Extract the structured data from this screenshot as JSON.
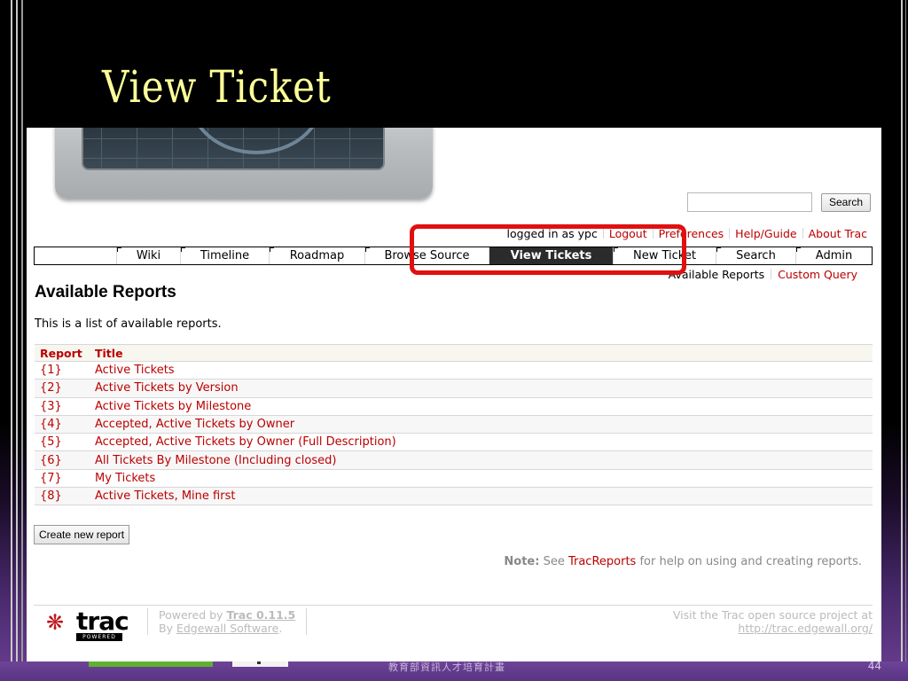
{
  "slide": {
    "title": "View Ticket",
    "footer_caption": "教育部資訊人才培育計畫",
    "page_number": "44"
  },
  "search": {
    "button_label": "Search",
    "placeholder": ""
  },
  "metanav": {
    "login_text": "logged in as ypc",
    "links": [
      "Logout",
      "Preferences",
      "Help/Guide",
      "About Trac"
    ]
  },
  "mainnav": {
    "items": [
      "Wiki",
      "Timeline",
      "Roadmap",
      "Browse Source",
      "View Tickets",
      "New Ticket",
      "Search",
      "Admin"
    ],
    "active": "View Tickets"
  },
  "ctxnav": {
    "current": "Available Reports",
    "link": "Custom Query"
  },
  "page": {
    "heading": "Available Reports",
    "intro": "This is a list of available reports."
  },
  "reports": {
    "columns": [
      "Report",
      "Title"
    ],
    "rows": [
      {
        "id": "{1}",
        "title": "Active Tickets"
      },
      {
        "id": "{2}",
        "title": "Active Tickets by Version"
      },
      {
        "id": "{3}",
        "title": "Active Tickets by Milestone"
      },
      {
        "id": "{4}",
        "title": "Accepted, Active Tickets by Owner"
      },
      {
        "id": "{5}",
        "title": "Accepted, Active Tickets by Owner (Full Description)"
      },
      {
        "id": "{6}",
        "title": "All Tickets By Milestone (Including closed)"
      },
      {
        "id": "{7}",
        "title": "My Tickets"
      },
      {
        "id": "{8}",
        "title": "Active Tickets, Mine first"
      }
    ]
  },
  "create_button": "Create new report",
  "note": {
    "label": "Note:",
    "before": "See",
    "link": "TracReports",
    "after": "for help on using and creating reports."
  },
  "footer": {
    "logo_text": "trac",
    "logo_badge": "POWERED",
    "powered_by": "Powered by",
    "trac_version": "Trac 0.11.5",
    "by": "By",
    "company": "Edgewall Software",
    "visit": "Visit the Trac open source project at",
    "url": "http://trac.edgewall.org/"
  },
  "colors": {
    "link": "#bb0000",
    "active_tab": "#2b2b2b",
    "highlight": "#e01010",
    "title": "#ffff99"
  }
}
